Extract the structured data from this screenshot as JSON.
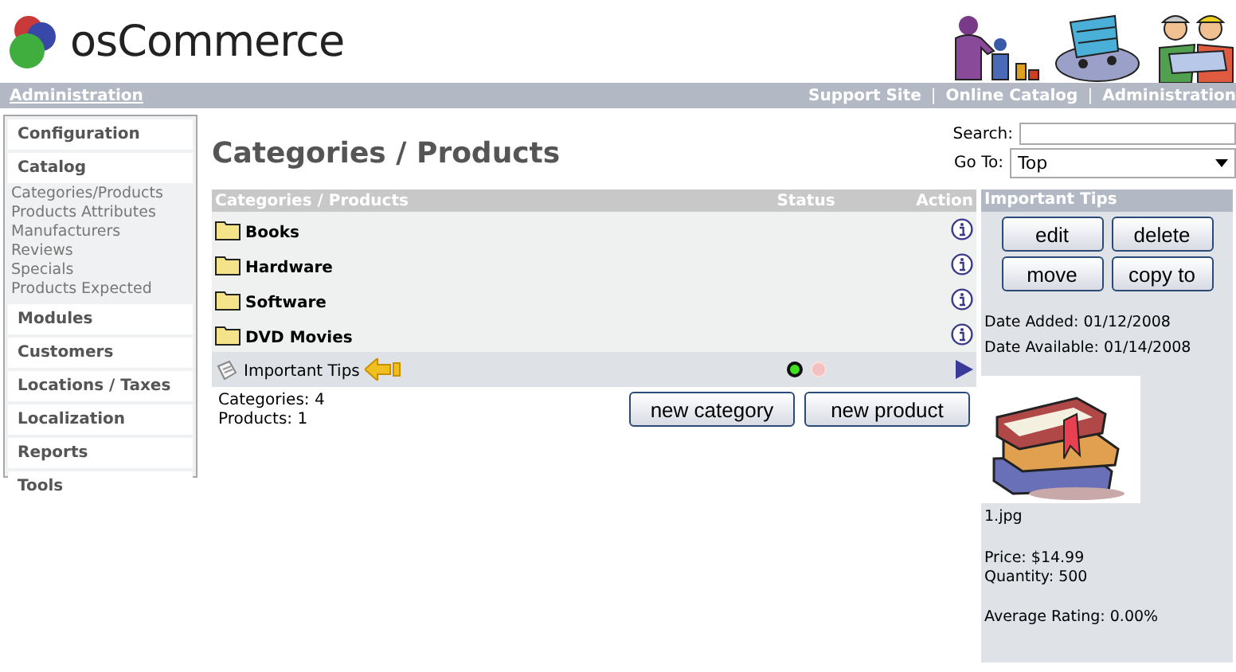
{
  "header": {
    "logo_text": "osCommerce"
  },
  "top_bar": {
    "home_link": "Administration",
    "links": [
      "Support Site",
      "Online Catalog",
      "Administration"
    ],
    "separator": "|"
  },
  "sidebar": {
    "sections": [
      {
        "label": "Configuration"
      },
      {
        "label": "Catalog",
        "items": [
          "Categories/Products",
          "Products Attributes",
          "Manufacturers",
          "Reviews",
          "Specials",
          "Products Expected"
        ]
      },
      {
        "label": "Modules"
      },
      {
        "label": "Customers"
      },
      {
        "label": "Locations / Taxes"
      },
      {
        "label": "Localization"
      },
      {
        "label": "Reports"
      },
      {
        "label": "Tools"
      }
    ]
  },
  "title": "Categories / Products",
  "search": {
    "label": "Search:"
  },
  "goto": {
    "label": "Go To:",
    "value": "Top"
  },
  "table": {
    "columns": [
      "Categories / Products",
      "Status",
      "Action"
    ],
    "rows": [
      {
        "kind": "category",
        "name": "Books",
        "selected": false
      },
      {
        "kind": "category",
        "name": "Hardware",
        "selected": false
      },
      {
        "kind": "category",
        "name": "Software",
        "selected": false
      },
      {
        "kind": "category",
        "name": "DVD Movies",
        "selected": false
      },
      {
        "kind": "product",
        "name": "Important Tips",
        "selected": true,
        "status": true
      }
    ]
  },
  "summary": [
    "Categories: 4",
    "Products: 1"
  ],
  "buttons": [
    "new category",
    "new product"
  ],
  "info": {
    "title": "Important Tips",
    "buttons": [
      "edit",
      "delete",
      "move",
      "copy to"
    ],
    "dates": [
      "Date Added: 01/12/2008",
      "Date Available: 01/14/2008"
    ],
    "image_caption": "1.jpg",
    "details": [
      "Price: $14.99",
      "Quantity: 500"
    ],
    "rating": "Average Rating: 0.00%"
  }
}
